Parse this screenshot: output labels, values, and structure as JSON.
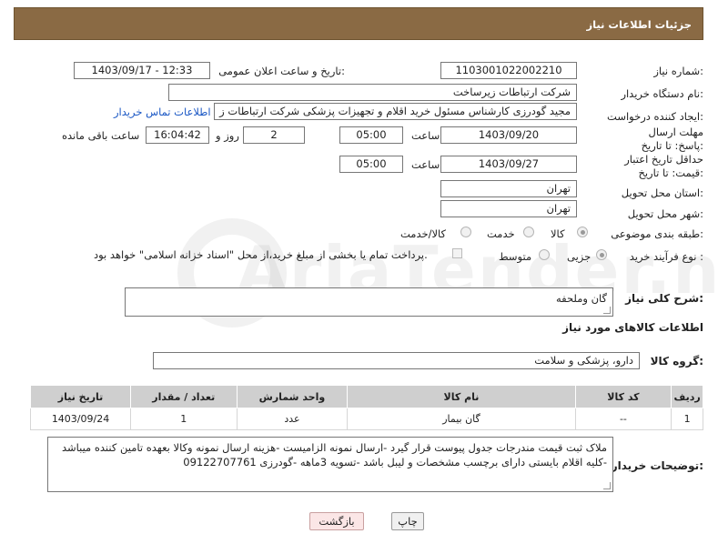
{
  "header": {
    "title": "جزئیات اطلاعات نیاز"
  },
  "form": {
    "need_number_label": "شماره نیاز:",
    "need_number": "1103001022002210",
    "announce_label": "تاریخ و ساعت اعلان عمومی:",
    "announce_value": "1403/09/17 - 12:33",
    "buyer_org_label": "نام دستگاه خریدار:",
    "buyer_org": "شرکت ارتباطات زیرساخت",
    "creator_label": "ایجاد کننده درخواست:",
    "creator": "مجید گودرزی کارشناس مسئول خرید اقلام و تجهیزات پزشکی شرکت ارتباطات ز",
    "contact_link": "اطلاعات تماس خریدار",
    "reply_deadline_label": "مهلت ارسال پاسخ: تا تاریخ:",
    "reply_date": "1403/09/20",
    "time_label": "ساعت",
    "reply_time": "05:00",
    "days_value": "2",
    "days_label": "روز و",
    "remaining_time": "16:04:42",
    "remaining_label": "ساعت باقی مانده",
    "validity_label": "حداقل تاریخ اعتبار قیمت: تا تاریخ:",
    "validity_date": "1403/09/27",
    "validity_time": "05:00",
    "province_label": "استان محل تحویل:",
    "province": "تهران",
    "city_label": "شهر محل تحویل:",
    "city": "تهران",
    "category_label": "طبقه بندی موضوعی:",
    "category_options": [
      "کالا",
      "خدمت",
      "کالا/خدمت"
    ],
    "process_label": "نوع فرآیند خرید :",
    "process_options": [
      "جزیی",
      "متوسط"
    ],
    "payment_note": "پرداخت تمام یا بخشی از مبلغ خرید،از محل \"اسناد خزانه اسلامی\" خواهد بود."
  },
  "summary": {
    "label": "شرح کلی نیاز:",
    "value": "گان وملحفه"
  },
  "goods_section": {
    "title": "اطلاعات کالاهای مورد نیاز",
    "group_label": "گروه کالا:",
    "group_value": "دارو، پزشکی و سلامت"
  },
  "table": {
    "headers": [
      "ردیف",
      "کد کالا",
      "نام کالا",
      "واحد شمارش",
      "تعداد / مقدار",
      "تاریخ نیاز"
    ],
    "rows": [
      [
        "1",
        "--",
        "گان بیمار",
        "عدد",
        "1",
        "1403/09/24"
      ]
    ]
  },
  "buyer_notes": {
    "label": "توضیحات خریدار:",
    "value": "ملاک ثبت قیمت مندرجات جدول پیوست قرار گیرد -ارسال نمونه الزامیست -هزینه ارسال نمونه وکالا بعهده تامین کننده میباشد -کلیه اقلام بایستی دارای برچسب مشخصات و لیبل  باشد -تسویه 3ماهه -گودرزی 09122707761"
  },
  "buttons": {
    "print": "چاپ",
    "back": "بازگشت"
  },
  "watermark": "AriaTender.net",
  "colors": {
    "header_bg": "#8a6a44",
    "link": "#1a57c4"
  }
}
